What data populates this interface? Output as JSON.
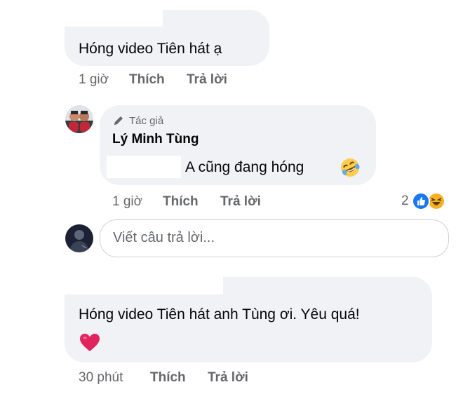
{
  "comments": [
    {
      "text": "Hóng video Tiên hát ạ",
      "time": "1 giờ",
      "like": "Thích",
      "reply": "Trả lời"
    },
    {
      "badge": "Tác giả",
      "author": "Lý Minh Tùng",
      "text": "A cũng đang hóng",
      "time": "1 giờ",
      "like": "Thích",
      "reply": "Trả lời",
      "reaction_count": "2"
    },
    {
      "text": "Hóng video Tiên hát anh Tùng ơi. Yêu quá!",
      "time": "30 phút",
      "like": "Thích",
      "reply": "Trả lời"
    }
  ],
  "reply_input": {
    "placeholder": "Viết câu trả lời..."
  },
  "icons": {
    "author_badge": "pen-icon",
    "laugh_emoji": "rolling-laughing-emoji",
    "like_reaction": "thumbs-up-reaction-icon",
    "haha_reaction": "haha-reaction-icon",
    "heart": "red-heart-emoji"
  },
  "colors": {
    "bubble": "#f0f2f5",
    "meta_text": "#65676b",
    "like_blue": "#1877f2",
    "haha_yellow": "#f7b125",
    "heart_red": "#e0245e"
  }
}
